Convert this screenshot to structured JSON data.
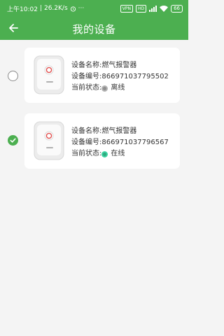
{
  "status_bar": {
    "time": "上午10:02",
    "speed": "26.2K/s",
    "vpn": "VPN",
    "hd": "HD",
    "battery": "66"
  },
  "header": {
    "title": "我的设备",
    "back_icon": "arrow-left-icon"
  },
  "devices": [
    {
      "name_label": "设备名称:",
      "name": "燃气报警器",
      "id_label": "设备编号:",
      "id": "866971037795502",
      "status_label": "当前状态:",
      "status": "离线",
      "status_color": "#9e9e9e",
      "selected": false
    },
    {
      "name_label": "设备名称:",
      "name": "燃气报警器",
      "id_label": "设备编号:",
      "id": "866971037796567",
      "status_label": "当前状态:",
      "status": "在线",
      "status_color": "#2bbf8a",
      "selected": true
    }
  ],
  "colors": {
    "brand": "#4caf50",
    "background": "#f4f4f4"
  }
}
